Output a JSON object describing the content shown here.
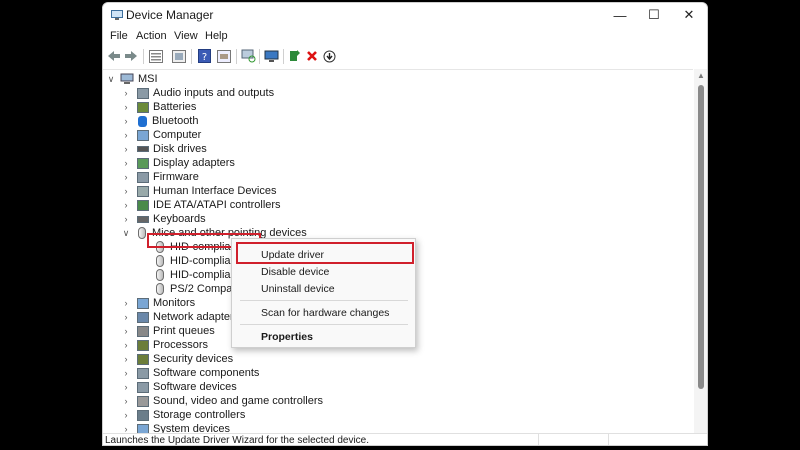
{
  "window": {
    "title": "Device Manager",
    "controls": {
      "minimize": "—",
      "maximize": "☐",
      "close": "✕"
    }
  },
  "menubar": [
    "File",
    "Action",
    "View",
    "Help"
  ],
  "toolbar_icons": [
    "back-arrow-icon",
    "forward-arrow-icon",
    "properties-icon",
    "show-hide-icon",
    "help-icon",
    "driver-icon",
    "scan-computer-icon",
    "add-legacy-icon",
    "uninstall-x-icon",
    "update-driver-icon"
  ],
  "tree": {
    "root": "MSI",
    "items": [
      {
        "label": "Audio inputs and outputs",
        "expanded": false
      },
      {
        "label": "Batteries",
        "expanded": false
      },
      {
        "label": "Bluetooth",
        "expanded": false
      },
      {
        "label": "Computer",
        "expanded": false
      },
      {
        "label": "Disk drives",
        "expanded": false
      },
      {
        "label": "Display adapters",
        "expanded": false
      },
      {
        "label": "Firmware",
        "expanded": false
      },
      {
        "label": "Human Interface Devices",
        "expanded": false
      },
      {
        "label": "IDE ATA/ATAPI controllers",
        "expanded": false
      },
      {
        "label": "Keyboards",
        "expanded": false
      },
      {
        "label": "Mice and other pointing devices",
        "expanded": true,
        "children": [
          "HID-compliant m",
          "HID-compliant m",
          "HID-compliant m",
          "PS/2 Compatible"
        ]
      },
      {
        "label": "Monitors",
        "expanded": false
      },
      {
        "label": "Network adapters",
        "expanded": false
      },
      {
        "label": "Print queues",
        "expanded": false
      },
      {
        "label": "Processors",
        "expanded": false
      },
      {
        "label": "Security devices",
        "expanded": false
      },
      {
        "label": "Software components",
        "expanded": false
      },
      {
        "label": "Software devices",
        "expanded": false
      },
      {
        "label": "Sound, video and game controllers",
        "expanded": false
      },
      {
        "label": "Storage controllers",
        "expanded": false
      },
      {
        "label": "System devices",
        "expanded": false
      }
    ]
  },
  "context_menu": {
    "items": [
      "Update driver",
      "Disable device",
      "Uninstall device",
      "Scan for hardware changes",
      "Properties"
    ],
    "highlighted": "Update driver"
  },
  "status": {
    "text": "Launches the Update Driver Wizard for the selected device."
  },
  "colors": {
    "highlight_border": "#d0202c",
    "window_bg": "#ffffff",
    "backdrop": "#000000"
  }
}
